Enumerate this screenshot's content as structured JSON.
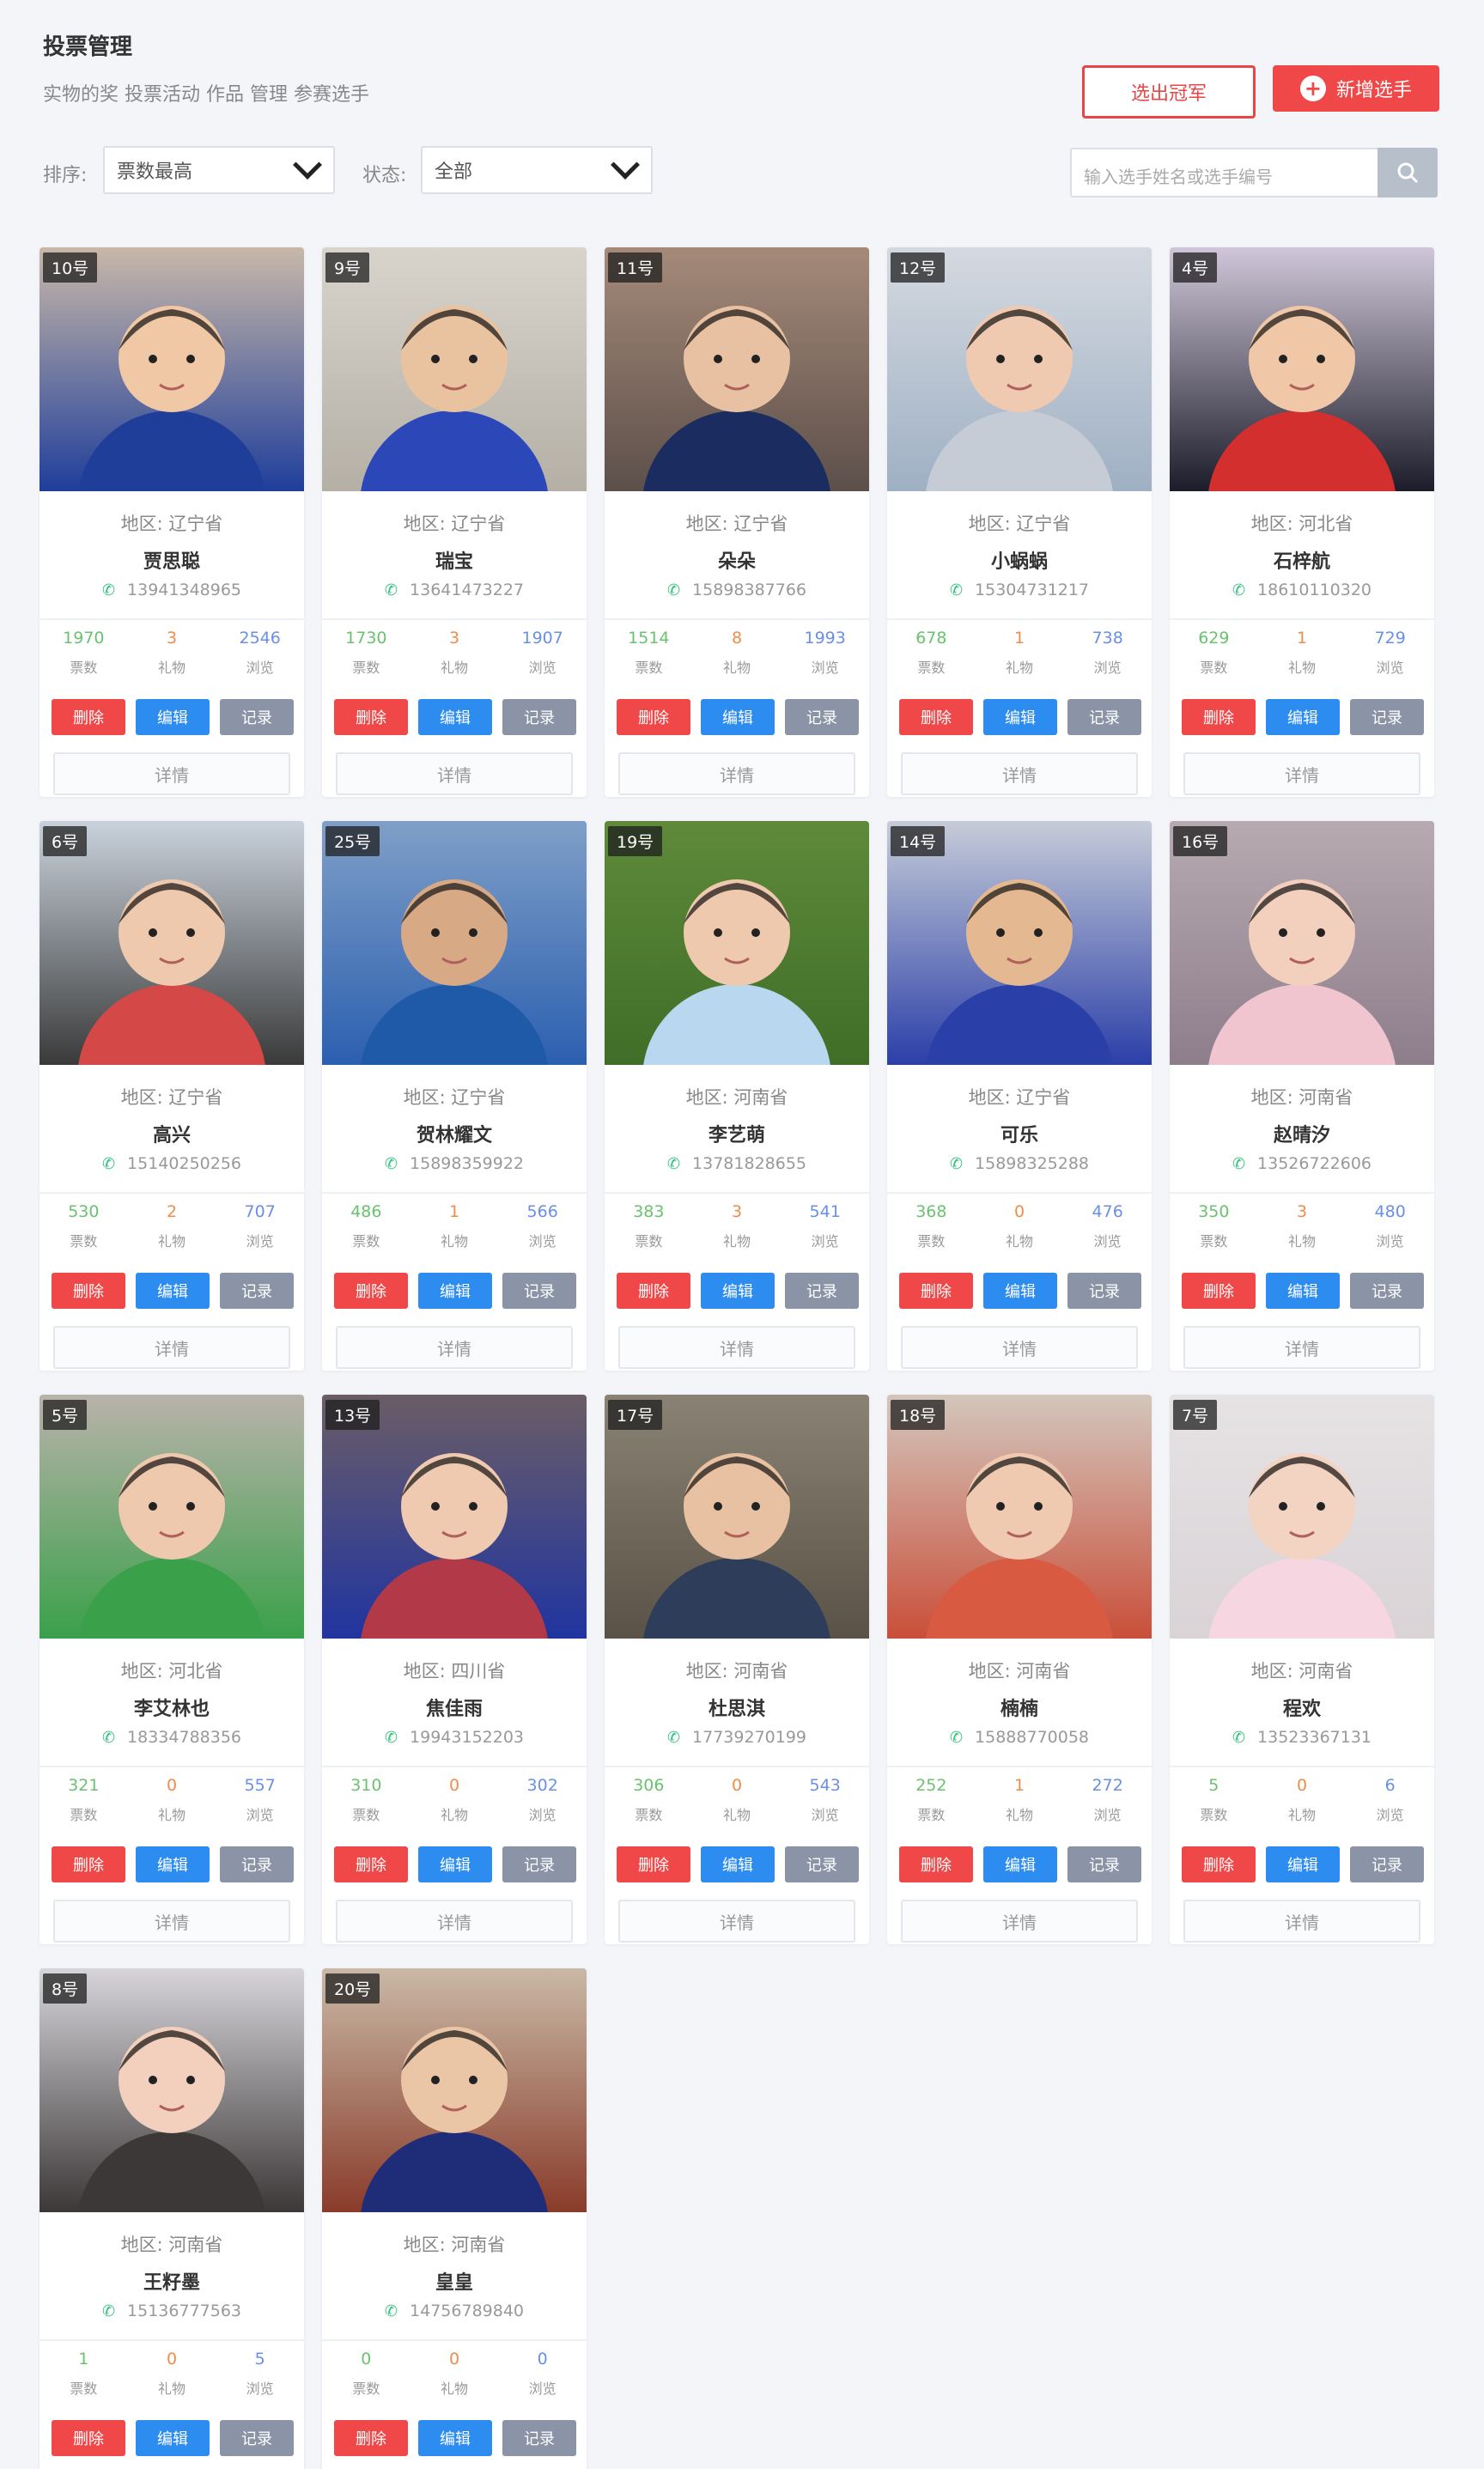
{
  "header": {
    "title": "投票管理",
    "subtitle": "实物的奖 投票活动 作品 管理 参赛选手",
    "btn_outline_label": "选出冠军",
    "btn_add_label": "新增选手"
  },
  "filters": {
    "sort_label": "排序:",
    "sort_value": "票数最高",
    "status_label": "状态:",
    "status_value": "全部",
    "search_placeholder": "输入选手姓名或选手编号"
  },
  "stat_labels": {
    "votes": "票数",
    "gifts": "礼物",
    "views": "浏览"
  },
  "action_labels": {
    "delete": "删除",
    "edit": "编辑",
    "record": "记录",
    "detail": "详情"
  },
  "cards": [
    {
      "no": "10号",
      "area": "地区: 辽宁省",
      "name": "贾思聪",
      "phone": "13941348965",
      "votes": "1970",
      "gifts": "3",
      "views": "2546",
      "photo": {
        "bg1": "#c9b8a8",
        "bg2": "#1f3e9a",
        "skin": "#f0c8a6",
        "shirt": "#1f3e9a"
      }
    },
    {
      "no": "9号",
      "area": "地区: 辽宁省",
      "name": "瑞宝",
      "phone": "13641473227",
      "votes": "1730",
      "gifts": "3",
      "views": "1907",
      "photo": {
        "bg1": "#d8d4cc",
        "bg2": "#b5b0a6",
        "skin": "#e9c3a0",
        "shirt": "#2c48b8"
      }
    },
    {
      "no": "11号",
      "area": "地区: 辽宁省",
      "name": "朵朵",
      "phone": "15898387766",
      "votes": "1514",
      "gifts": "8",
      "views": "1993",
      "photo": {
        "bg1": "#a58a79",
        "bg2": "#5c4f4a",
        "skin": "#e8c1a2",
        "shirt": "#1b2c60"
      }
    },
    {
      "no": "12号",
      "area": "地区: 辽宁省",
      "name": "小蜗蜗",
      "phone": "15304731217",
      "votes": "678",
      "gifts": "1",
      "views": "738",
      "photo": {
        "bg1": "#d4d9e0",
        "bg2": "#9fb0c4",
        "skin": "#f0cab0",
        "shirt": "#c6ccd6"
      }
    },
    {
      "no": "4号",
      "area": "地区: 河北省",
      "name": "石梓航",
      "phone": "18610110320",
      "votes": "629",
      "gifts": "1",
      "views": "729",
      "photo": {
        "bg1": "#cfc7d9",
        "bg2": "#1c1c2a",
        "skin": "#f0c8a8",
        "shirt": "#d42f2f"
      }
    },
    {
      "no": "6号",
      "area": "地区: 辽宁省",
      "name": "高兴",
      "phone": "15140250256",
      "votes": "530",
      "gifts": "2",
      "views": "707",
      "photo": {
        "bg1": "#c9d2dc",
        "bg2": "#3a3a3a",
        "skin": "#efc9ae",
        "shirt": "#d44848"
      }
    },
    {
      "no": "25号",
      "area": "地区: 辽宁省",
      "name": "贺林耀文",
      "phone": "15898359922",
      "votes": "486",
      "gifts": "1",
      "views": "566",
      "photo": {
        "bg1": "#7f9fc7",
        "bg2": "#2b5fb0",
        "skin": "#d7a985",
        "shirt": "#1e5aa8"
      }
    },
    {
      "no": "19号",
      "area": "地区: 河南省",
      "name": "李艺萌",
      "phone": "13781828655",
      "votes": "383",
      "gifts": "3",
      "views": "541",
      "photo": {
        "bg1": "#5f8a3a",
        "bg2": "#3f6e28",
        "skin": "#efc9ae",
        "shirt": "#b9d7ee"
      }
    },
    {
      "no": "14号",
      "area": "地区: 辽宁省",
      "name": "可乐",
      "phone": "15898325288",
      "votes": "368",
      "gifts": "0",
      "views": "476",
      "photo": {
        "bg1": "#c6ccd8",
        "bg2": "#2b3fa8",
        "skin": "#e4b890",
        "shirt": "#2b3fa8"
      }
    },
    {
      "no": "16号",
      "area": "地区: 河南省",
      "name": "赵晴汐",
      "phone": "13526722606",
      "votes": "350",
      "gifts": "3",
      "views": "480",
      "photo": {
        "bg1": "#b7aab0",
        "bg2": "#8e7e8c",
        "skin": "#f3cfbd",
        "shirt": "#f1c5cf"
      }
    },
    {
      "no": "5号",
      "area": "地区: 河北省",
      "name": "李艾林也",
      "phone": "18334788356",
      "votes": "321",
      "gifts": "0",
      "views": "557",
      "photo": {
        "bg1": "#b9b2aa",
        "bg2": "#3aa04a",
        "skin": "#efc9ae",
        "shirt": "#3aa04a"
      }
    },
    {
      "no": "13号",
      "area": "地区: 四川省",
      "name": "焦佳雨",
      "phone": "19943152203",
      "votes": "310",
      "gifts": "0",
      "views": "302",
      "photo": {
        "bg1": "#6b5d66",
        "bg2": "#2034a0",
        "skin": "#f0cab0",
        "shirt": "#b23a48"
      }
    },
    {
      "no": "17号",
      "area": "地区: 河南省",
      "name": "杜思淇",
      "phone": "17739270199",
      "votes": "306",
      "gifts": "0",
      "views": "543",
      "photo": {
        "bg1": "#8a8274",
        "bg2": "#5a5246",
        "skin": "#e8c1a2",
        "shirt": "#2d3d5a"
      }
    },
    {
      "no": "18号",
      "area": "地区: 河南省",
      "name": "楠楠",
      "phone": "15888770058",
      "votes": "252",
      "gifts": "1",
      "views": "272",
      "photo": {
        "bg1": "#d3c6bc",
        "bg2": "#c94f3a",
        "skin": "#f0cab0",
        "shirt": "#d85a40"
      }
    },
    {
      "no": "7号",
      "area": "地区: 河南省",
      "name": "程欢",
      "phone": "13523367131",
      "votes": "5",
      "gifts": "0",
      "views": "6",
      "photo": {
        "bg1": "#e6e3e5",
        "bg2": "#d9d3d6",
        "skin": "#f3d3c2",
        "shirt": "#f6d6e0"
      }
    },
    {
      "no": "8号",
      "area": "地区: 河南省",
      "name": "王籽墨",
      "phone": "15136777563",
      "votes": "1",
      "gifts": "0",
      "views": "5",
      "photo": {
        "bg1": "#d7d5da",
        "bg2": "#3c3838",
        "skin": "#f2d0bd",
        "shirt": "#3c3838"
      }
    },
    {
      "no": "20号",
      "area": "地区: 河南省",
      "name": "皇皇",
      "phone": "14756789840",
      "votes": "0",
      "gifts": "0",
      "views": "0",
      "photo": {
        "bg1": "#c9b9a6",
        "bg2": "#8a3b2a",
        "skin": "#eac5a6",
        "shirt": "#1f2d78"
      }
    }
  ]
}
